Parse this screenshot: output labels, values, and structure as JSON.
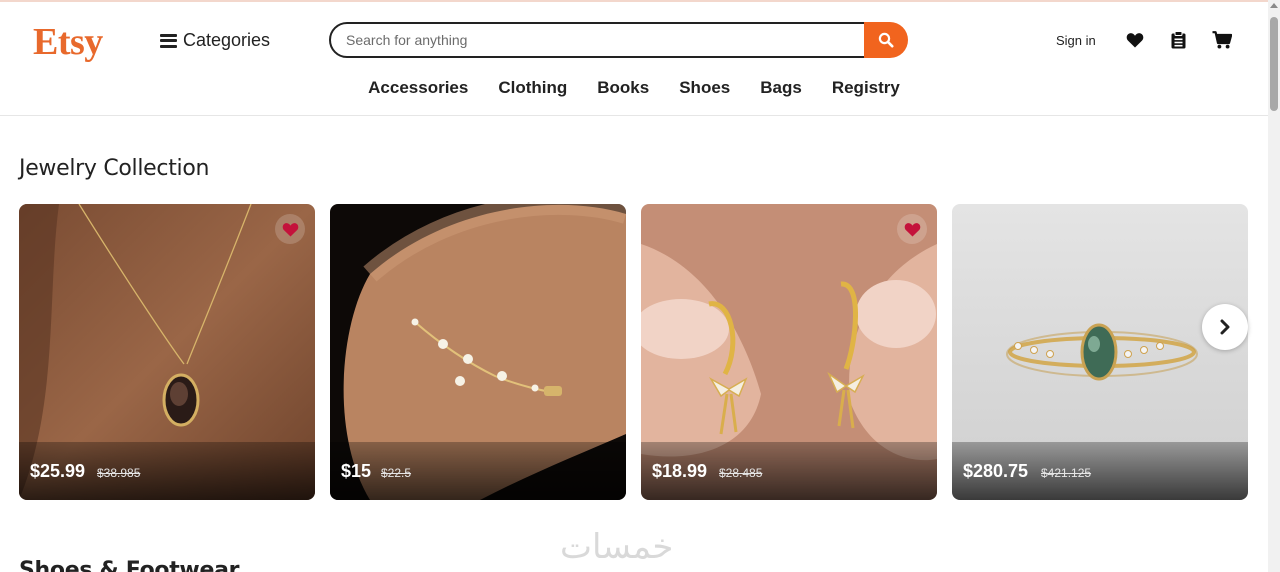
{
  "header": {
    "logo": "Etsy",
    "categories_label": "Categories",
    "search_placeholder": "Search for anything",
    "search_value": "",
    "signin_label": "Sign in",
    "accent_color": "#f1641e"
  },
  "nav": {
    "items": [
      "Accessories",
      "Clothing",
      "Books",
      "Shoes",
      "Bags",
      "Registry"
    ]
  },
  "sections": {
    "jewelry_title": "Jewelry Collection",
    "shoes_title": "Shoes & Footwear"
  },
  "products": [
    {
      "price": "$25.99",
      "old_price": "$38.985",
      "favorited": true,
      "subject": "necklace"
    },
    {
      "price": "$15",
      "old_price": "$22.5",
      "favorited": false,
      "subject": "bracelet"
    },
    {
      "price": "$18.99",
      "old_price": "$28.485",
      "favorited": true,
      "subject": "earrings"
    },
    {
      "price": "$280.75",
      "old_price": "$421.125",
      "favorited": false,
      "subject": "ring"
    }
  ],
  "watermark": "خمسات",
  "icons": [
    "hamburger-icon",
    "search-icon",
    "heart-icon",
    "clipboard-icon",
    "cart-icon",
    "chevron-right-icon"
  ]
}
